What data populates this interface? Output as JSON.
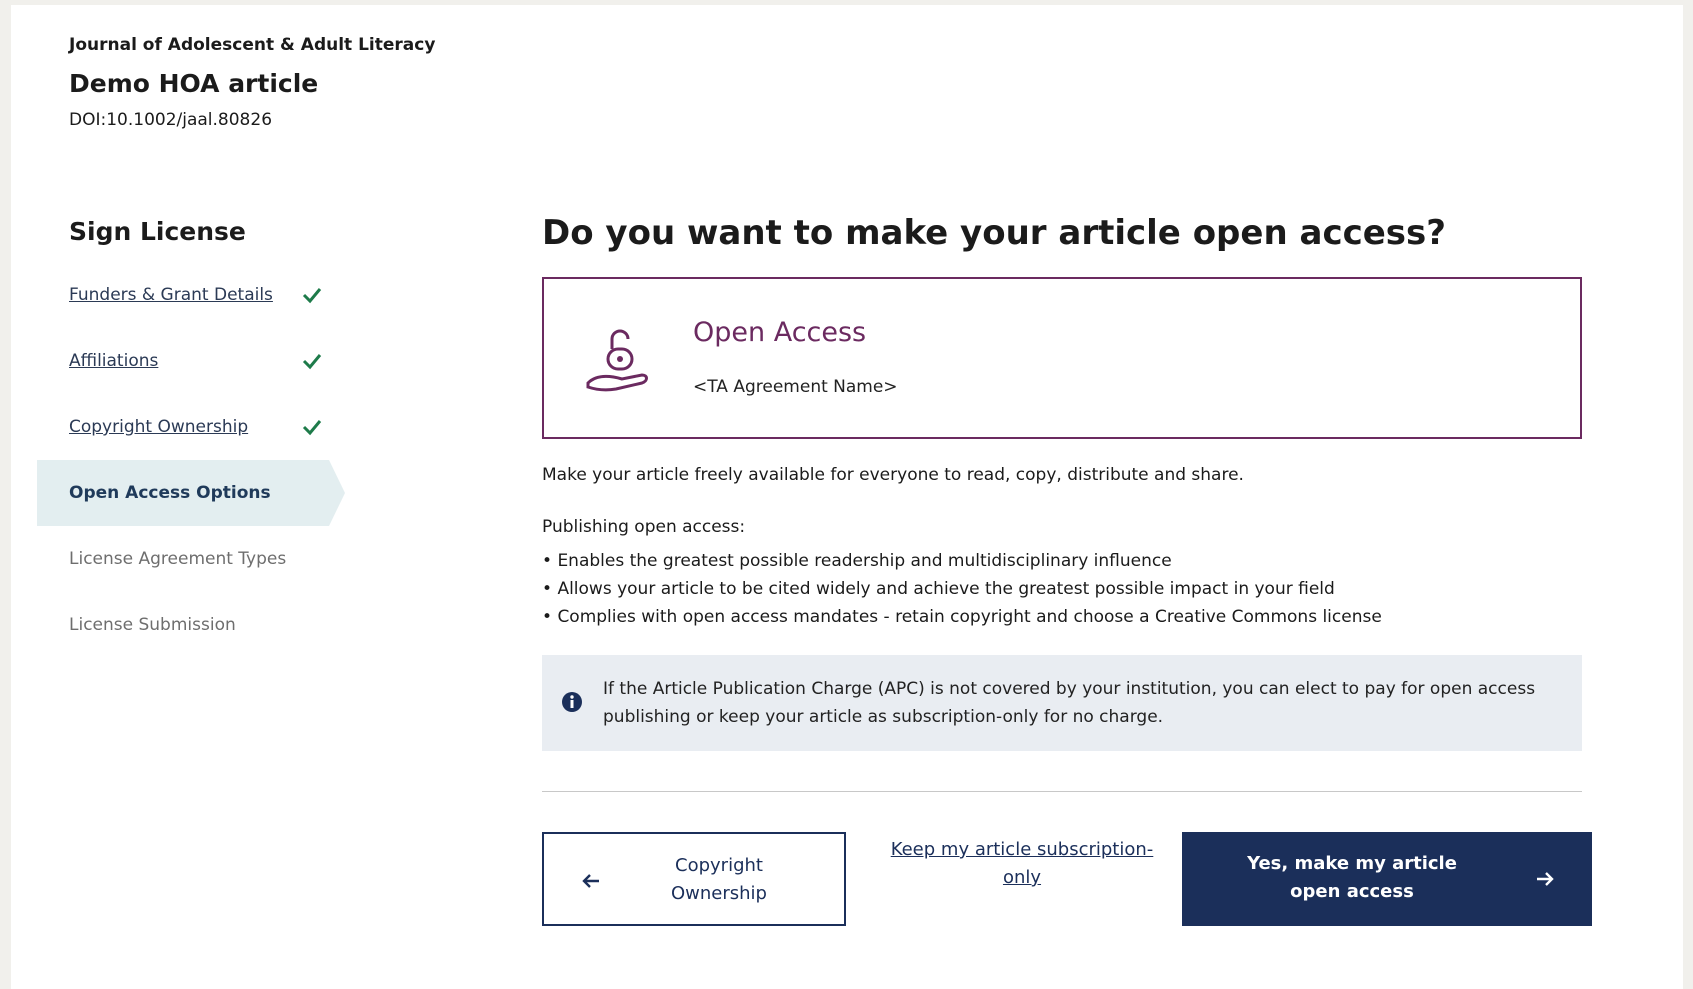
{
  "header": {
    "journal": "Journal of Adolescent & Adult Literacy",
    "article_title": "Demo HOA article",
    "doi": "DOI:10.1002/jaal.80826"
  },
  "sidebar": {
    "title": "Sign License",
    "steps": [
      {
        "label": "Funders & Grant Details",
        "state": "completed",
        "icon": "check-icon"
      },
      {
        "label": "Affiliations",
        "state": "completed",
        "icon": "check-icon"
      },
      {
        "label": "Copyright Ownership",
        "state": "completed",
        "icon": "check-icon"
      },
      {
        "label": "Open Access Options",
        "state": "active"
      },
      {
        "label": "License Agreement Types",
        "state": "disabled"
      },
      {
        "label": "License Submission",
        "state": "disabled"
      }
    ]
  },
  "main": {
    "heading": "Do you want to make your article open access?",
    "option_card": {
      "icon": "open-lock-hand-icon",
      "title": "Open Access",
      "subtitle": "<TA Agreement Name>"
    },
    "description": "Make your article freely available for everyone to read, copy, distribute and share.",
    "publishing_heading": "Publishing open access:",
    "bullets": [
      "Enables the greatest possible readership and multidisciplinary influence",
      "Allows your article to be cited widely and achieve the greatest possible impact in your field",
      "Complies with open access mandates - retain copyright and choose a Creative Commons license"
    ],
    "info": {
      "icon": "info-icon",
      "text": "If the Article Publication Charge (APC) is not covered by your institution, you can elect to pay for open access publishing or keep your article as subscription-only for no charge."
    }
  },
  "actions": {
    "back_label": "Copyright Ownership",
    "subscription_link": "Keep my article subscription-only",
    "confirm_label": "Yes, make my article open access"
  },
  "colors": {
    "primary": "#1b2f5a",
    "accent": "#6b2a60",
    "check": "#1e7b4a",
    "active_bg": "#e3eef0",
    "info_bg": "#e9edf2"
  }
}
